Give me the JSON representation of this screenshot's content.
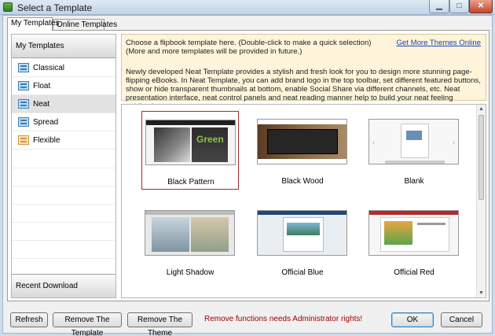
{
  "window": {
    "title": "Select a Template"
  },
  "tabs": [
    {
      "label": "My Templates"
    },
    {
      "label": "Online Templates"
    }
  ],
  "sidebar": {
    "header": "My Templates",
    "items": [
      {
        "label": "Classical",
        "icon": "layout-icon"
      },
      {
        "label": "Float",
        "icon": "layout-icon"
      },
      {
        "label": "Neat",
        "icon": "layout-icon",
        "selected": true
      },
      {
        "label": "Spread",
        "icon": "layout-icon"
      },
      {
        "label": "Flexible",
        "icon": "layout-icon"
      }
    ],
    "footer": "Recent Download"
  },
  "info": {
    "line1": "Choose a flipbook template here. (Double-click to make a quick selection)",
    "line2": "(More and more templates will be provided in future.)",
    "more_link": "Get More Themes Online",
    "description": "Newly developed Neat Template provides a stylish and fresh look for you to design more stunning page-flipping eBooks. In Neat Template, you can add brand logo in the top toolbar, set different featured buttons, show or hide transparent thumbnails at bottom, enable Social Share via different channels, etc. Neat presentation interface, neat control panels and neat reading manner help to build your neat feeling publications."
  },
  "templates": [
    {
      "name": "Black Pattern",
      "selected": true,
      "thumb_text": "Green"
    },
    {
      "name": "Black Wood"
    },
    {
      "name": "Blank"
    },
    {
      "name": "Light Shadow"
    },
    {
      "name": "Official Blue"
    },
    {
      "name": "Official Red"
    }
  ],
  "buttons": {
    "refresh": "Refresh",
    "remove_template": "Remove The Template",
    "remove_theme": "Remove The Theme",
    "ok": "OK",
    "cancel": "Cancel"
  },
  "warning": "Remove functions needs Administrator rights!",
  "colors": {
    "selection_border": "#a52a2a",
    "info_background": "#fdf4da",
    "link": "#1c43b7",
    "warning": "#a00000"
  }
}
